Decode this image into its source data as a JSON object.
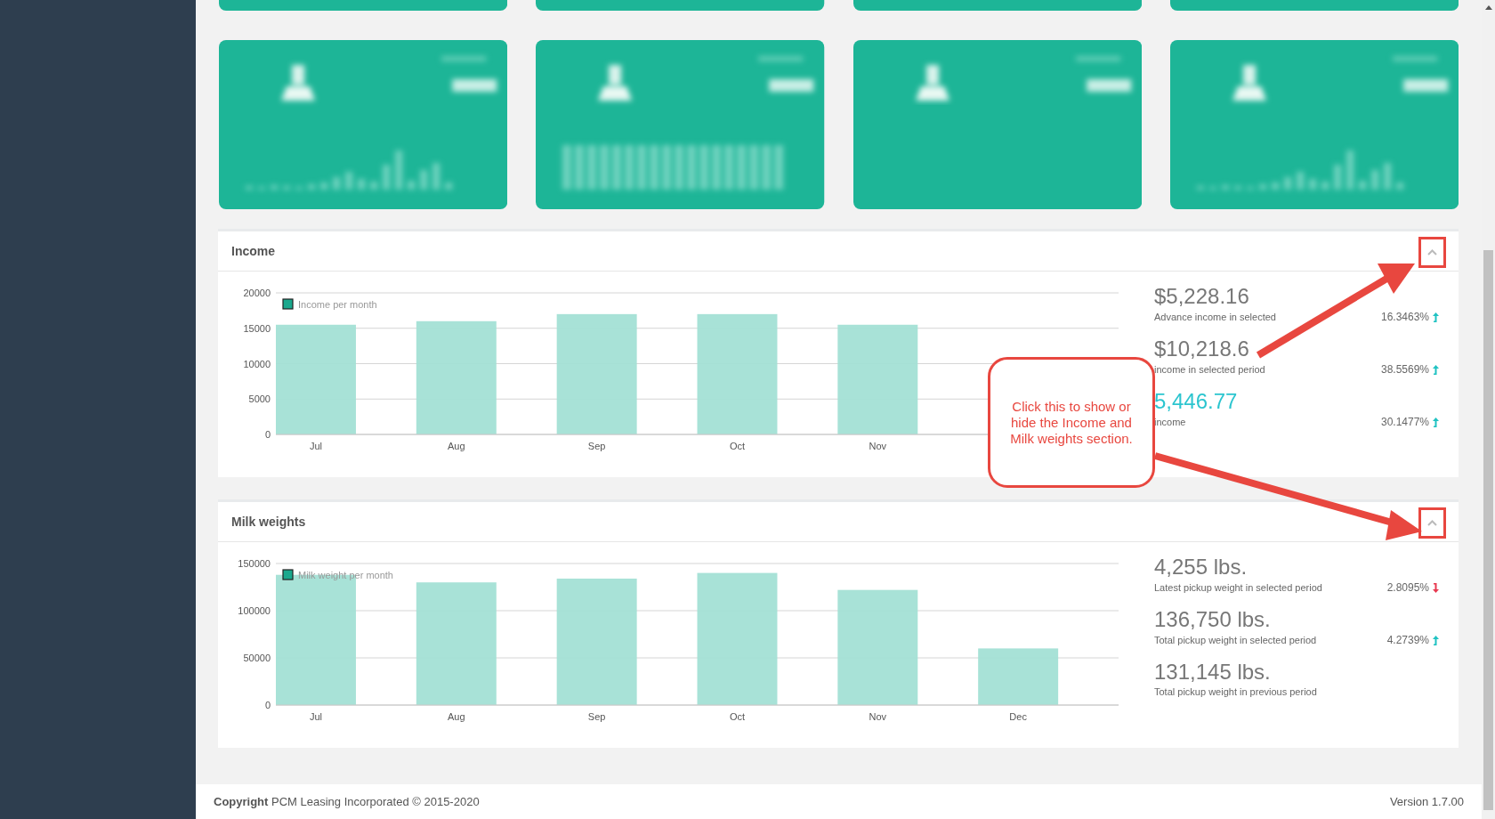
{
  "panels": [
    {
      "title": "Income",
      "collapsed": false,
      "chart_data": {
        "type": "bar",
        "grid": true,
        "categories": [
          "Jul",
          "Aug",
          "Sep",
          "Oct",
          "Nov"
        ],
        "series": [
          {
            "name": "Income per month",
            "color": "#a3e0d5",
            "values": [
              15500,
              16000,
              17000,
              17000,
              15500
            ]
          }
        ],
        "ylim": [
          0,
          20000
        ],
        "yticks": [
          0,
          5000,
          10000,
          15000,
          20000
        ]
      },
      "stats": [
        {
          "value": "$5,228.16",
          "label": "Advance income in selected",
          "change": "16.3463%",
          "rising": true,
          "highlight": false
        },
        {
          "value": "$10,218.6",
          "label": "income in selected period",
          "change": "38.5569%",
          "rising": true,
          "highlight": false
        },
        {
          "value": "5,446.77",
          "label": "income",
          "change": "30.1477%",
          "rising": true,
          "highlight": true
        }
      ]
    },
    {
      "title": "Milk weights",
      "collapsed": false,
      "chart_data": {
        "type": "bar",
        "grid": true,
        "categories": [
          "Jul",
          "Aug",
          "Sep",
          "Oct",
          "Nov",
          "Dec"
        ],
        "series": [
          {
            "name": "Milk weight per month",
            "color": "#a3e0d5",
            "values": [
              138000,
              130000,
              134000,
              140000,
              122000,
              60000
            ]
          }
        ],
        "ylim": [
          0,
          150000
        ],
        "yticks": [
          0,
          50000,
          100000,
          150000
        ]
      },
      "stats": [
        {
          "value": "4,255 lbs.",
          "label": "Latest pickup weight in selected period",
          "change": "2.8095%",
          "rising": false,
          "highlight": false
        },
        {
          "value": "136,750 lbs.",
          "label": "Total pickup weight in selected period",
          "change": "4.2739%",
          "rising": true,
          "highlight": false
        },
        {
          "value": "131,145 lbs.",
          "label": "Total pickup weight in previous period",
          "highlight": false
        }
      ]
    }
  ],
  "callout": {
    "text": "Click this to show or hide the Income and Milk weights section."
  },
  "footer": {
    "copyright": "**Copyright** PCM Leasing Incorporated © 2015-2020",
    "version": "Version 1.7.00"
  }
}
